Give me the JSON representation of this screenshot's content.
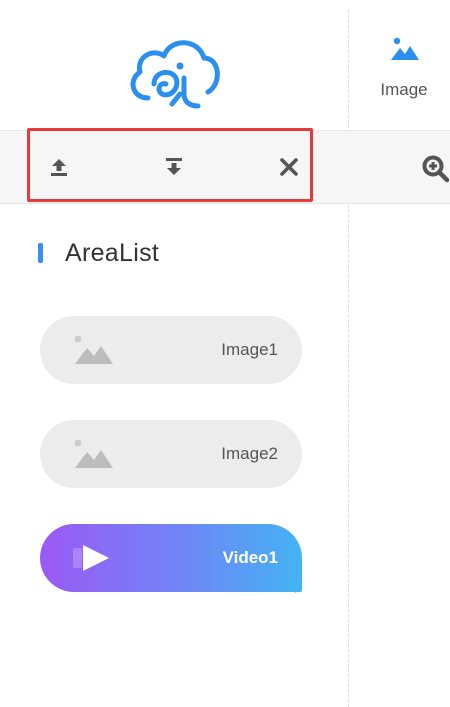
{
  "logo": {
    "icon": "cloud-logo-icon",
    "color": "#2b8ff0"
  },
  "toolbar": {
    "upload_icon": "upload-icon",
    "download_icon": "download-icon",
    "close_icon": "close-icon",
    "icon_color": "#555555",
    "highlight_color": "#e83a3a"
  },
  "area_list": {
    "title": "AreaList",
    "accent_color": "#3a8ef6",
    "items": [
      {
        "label": "Image1",
        "icon": "image-icon",
        "type": "image"
      },
      {
        "label": "Image2",
        "icon": "image-icon",
        "type": "image"
      },
      {
        "label": "Video1",
        "icon": "video-icon",
        "type": "video"
      }
    ]
  },
  "right_panel": {
    "image_tool": {
      "label": "Image",
      "icon": "image-icon",
      "color": "#2b8ff0"
    },
    "zoom_icon": "zoom-in-icon"
  }
}
